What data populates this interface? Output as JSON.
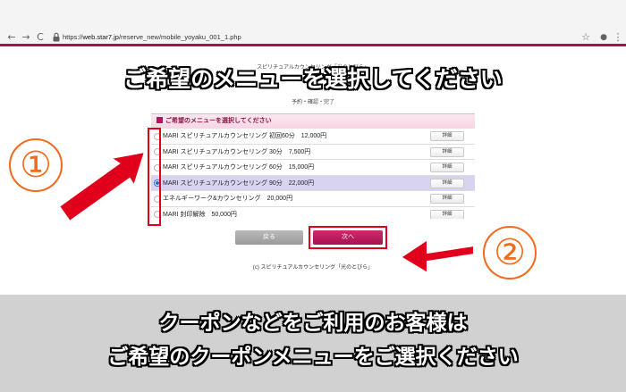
{
  "browser": {
    "url_prefix": "https://",
    "url_host": "web.star7.jp",
    "url_path": "/reserve_new/mobile_yoyaku_001_1.php",
    "back_icon": "←",
    "forward_icon": "→",
    "reload_icon": "C",
    "star_icon": "☆",
    "menu_icon": "⋮",
    "profile_icon": "●"
  },
  "page": {
    "site_title": "スピリチュアルカウンセリング「光のとびら」",
    "steps": "予約・確認・完了",
    "menu_header": "ご希望のメニューを選択してください",
    "menu_items": [
      {
        "label": "MARI スピリチュアルカウンセリング 初回60分　12,000円",
        "detail": "詳細",
        "selected": false
      },
      {
        "label": "MARI スピリチュアルカウンセリング 30分　7,500円",
        "detail": "詳細",
        "selected": false
      },
      {
        "label": "MARI スピリチュアルカウンセリング 60分　15,000円",
        "detail": "詳細",
        "selected": false
      },
      {
        "label": "MARI スピリチュアルカウンセリング 90分　22,000円",
        "detail": "詳細",
        "selected": true
      },
      {
        "label": "エネルギーワーク&カウンセリング　20,000円",
        "detail": "詳細",
        "selected": false
      },
      {
        "label": "MARI 封印解除　50,000円",
        "detail": "詳細",
        "selected": false
      }
    ],
    "back_button": "戻る",
    "next_button": "次へ",
    "footer": "(c) スピリチュアルカウンセリング「光のとびら」"
  },
  "overlay": {
    "top_caption": "ご希望のメニューを選択してください",
    "step1_number": "①",
    "step2_number": "②",
    "bottom_caption_line1": "クーポンなどをご利用のお客様は",
    "bottom_caption_line2": "ご希望のクーポンメニューをご選択ください",
    "accent_red": "#e0001b",
    "number_orange": "#f26a1b",
    "brand_magenta": "#a0134f"
  }
}
